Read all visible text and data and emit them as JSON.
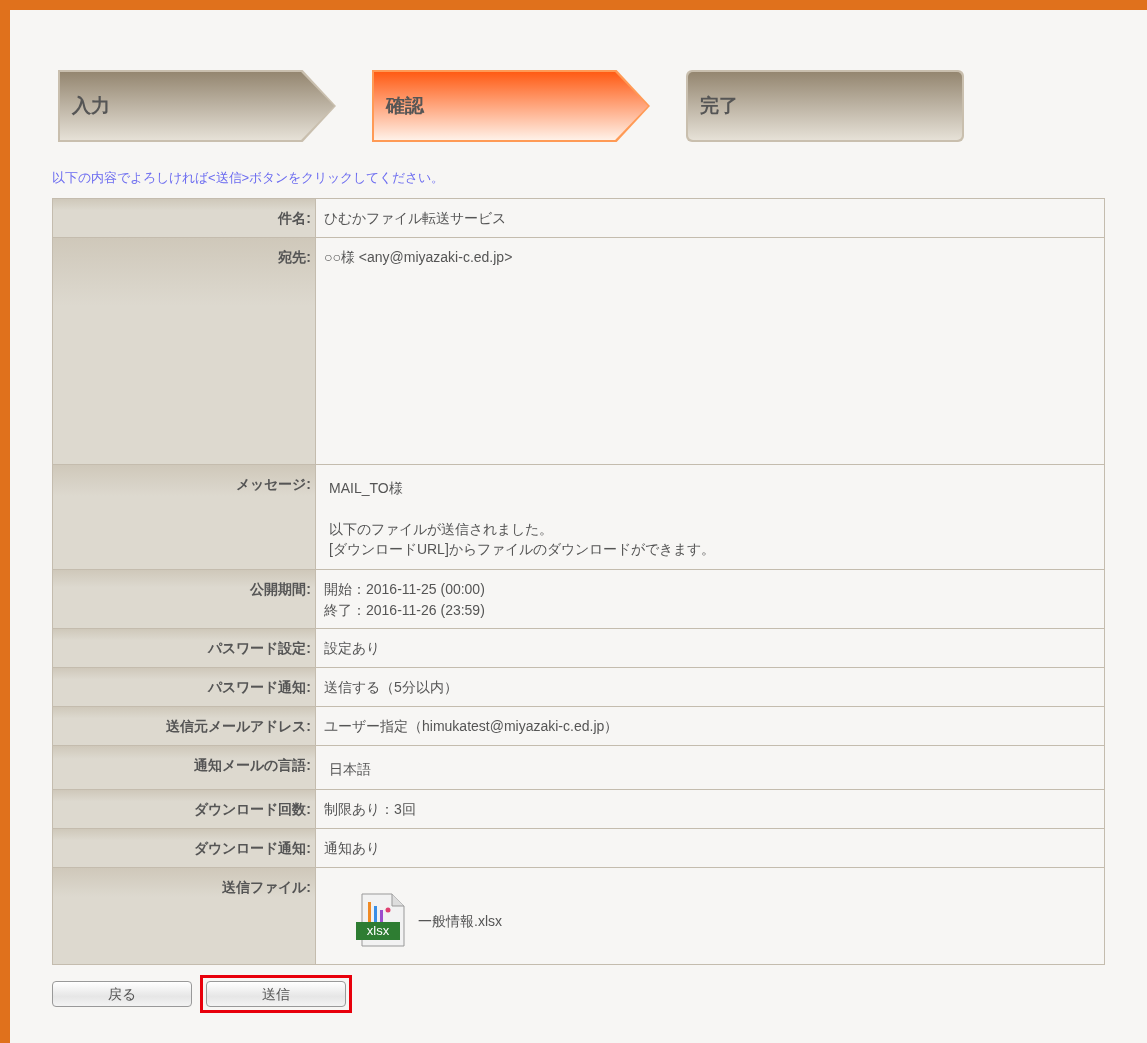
{
  "steps": [
    {
      "label": "入力",
      "kind": "arrow",
      "selected": false
    },
    {
      "label": "確認",
      "kind": "arrow",
      "selected": true
    },
    {
      "label": "完了",
      "kind": "end",
      "selected": false
    }
  ],
  "instruction": "以下の内容でよろしければ<送信>ボタンをクリックしてください。",
  "rows": [
    {
      "label": "件名:",
      "kind": "text",
      "lines": [
        "ひむかファイル転送サービス"
      ]
    },
    {
      "label": "宛先:",
      "kind": "tall",
      "lines": [
        "○○様 <any@miyazaki-c.ed.jp>"
      ]
    },
    {
      "label": "メッセージ:",
      "kind": "message",
      "lines": [
        "MAIL_TO様",
        "以下のファイルが送信されました。",
        "[ダウンロードURL]からファイルのダウンロードができます。"
      ]
    },
    {
      "label": "公開期間:",
      "kind": "text",
      "lines": [
        "開始：2016-11-25 (00:00)",
        "終了：2016-11-26 (23:59)"
      ]
    },
    {
      "label": "パスワード設定:",
      "kind": "text",
      "lines": [
        "設定あり"
      ]
    },
    {
      "label": "パスワード通知:",
      "kind": "text",
      "lines": [
        "送信する（5分以内）"
      ]
    },
    {
      "label": "送信元メールアドレス:",
      "kind": "text",
      "lines": [
        "ユーザー指定（himukatest@miyazaki-c.ed.jp）"
      ]
    },
    {
      "label": "通知メールの言語:",
      "kind": "message",
      "lines": [
        "日本語"
      ]
    },
    {
      "label": "ダウンロード回数:",
      "kind": "text",
      "lines": [
        "制限あり：3回"
      ]
    },
    {
      "label": "ダウンロード通知:",
      "kind": "text",
      "lines": [
        "通知あり"
      ]
    },
    {
      "label": "送信ファイル:",
      "kind": "file",
      "icon_label": "xlsx",
      "lines": [
        "一般情報.xlsx"
      ]
    }
  ],
  "buttons": [
    {
      "label": "戻る",
      "highlighted": false
    },
    {
      "label": "送信",
      "highlighted": true
    }
  ]
}
